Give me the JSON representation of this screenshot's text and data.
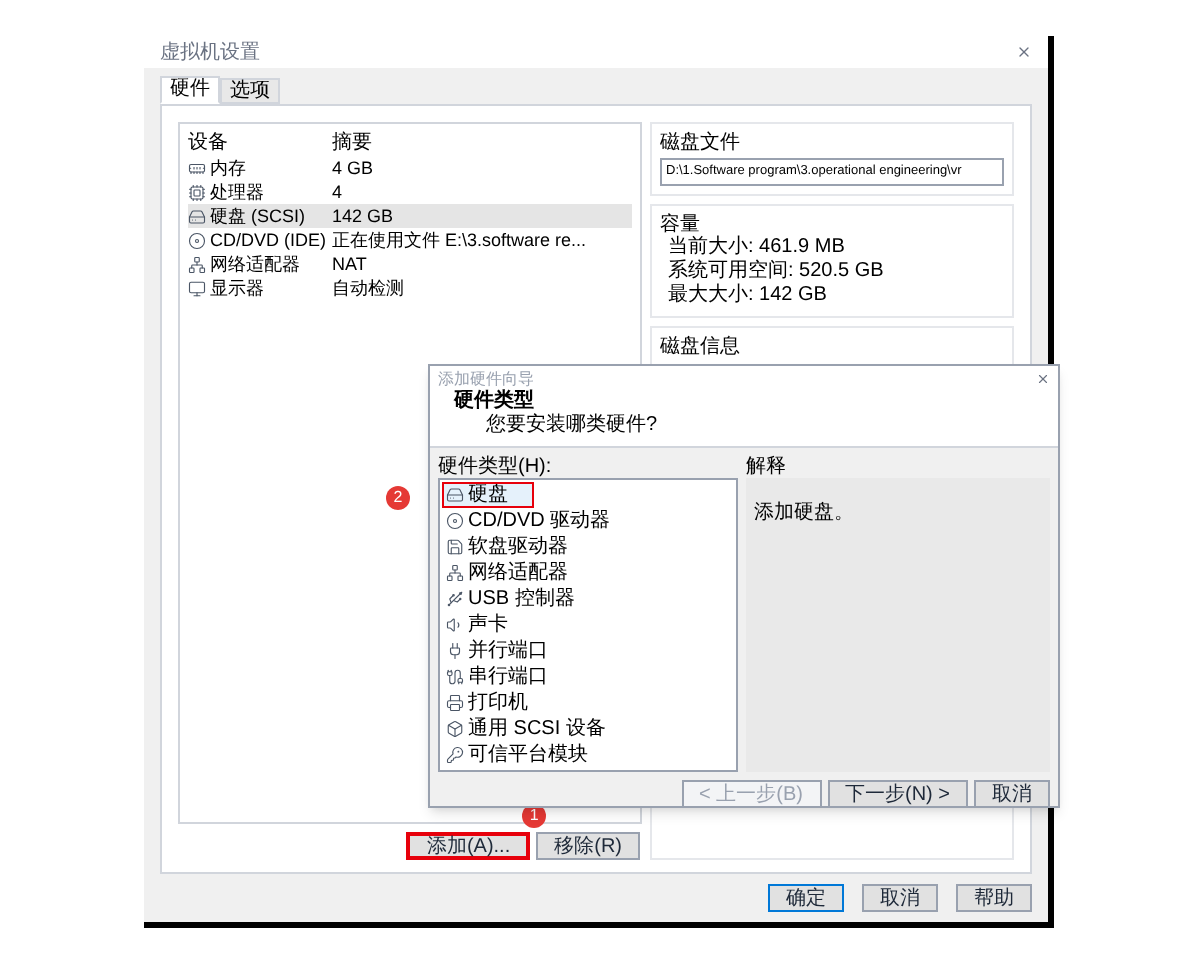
{
  "settings_window": {
    "title": "虚拟机设置",
    "tabs": [
      {
        "label": "硬件",
        "selected": true
      },
      {
        "label": "选项",
        "selected": false
      }
    ],
    "device_table": {
      "columns": [
        "设备",
        "摘要"
      ],
      "rows": [
        {
          "kind": "memory",
          "device": "内存",
          "summary": "4 GB",
          "selected": false
        },
        {
          "kind": "cpu",
          "device": "处理器",
          "summary": "4",
          "selected": false
        },
        {
          "kind": "disk",
          "device": "硬盘 (SCSI)",
          "summary": "142 GB",
          "selected": true
        },
        {
          "kind": "cdrom",
          "device": "CD/DVD (IDE)",
          "summary": "正在使用文件 E:\\3.software re...",
          "selected": false
        },
        {
          "kind": "network",
          "device": "网络适配器",
          "summary": "NAT",
          "selected": false
        },
        {
          "kind": "display",
          "device": "显示器",
          "summary": "自动检测",
          "selected": false
        }
      ]
    },
    "list_buttons": [
      "添加(A)...",
      "移除(R)"
    ],
    "disk_file": {
      "heading": "磁盘文件",
      "value": "D:\\1.Software program\\3.operational engineering\\vr"
    },
    "capacity": {
      "heading": "容量",
      "lines": [
        "当前大小: 461.9 MB",
        "系统可用空间: 520.5 GB",
        "最大大小: 142 GB"
      ]
    },
    "disk_info": {
      "heading": "磁盘信息"
    },
    "buttons": [
      "确定",
      "取消",
      "帮助"
    ]
  },
  "wizard": {
    "title": "添加硬件向导",
    "heading": "硬件类型",
    "subheading": "您要安装哪类硬件?",
    "list_label": "硬件类型(H):",
    "items": [
      {
        "kind": "disk",
        "label": "硬盘",
        "selected": true
      },
      {
        "kind": "cdrom",
        "label": "CD/DVD 驱动器",
        "selected": false
      },
      {
        "kind": "floppy",
        "label": "软盘驱动器",
        "selected": false
      },
      {
        "kind": "network",
        "label": "网络适配器",
        "selected": false
      },
      {
        "kind": "usb",
        "label": "USB 控制器",
        "selected": false
      },
      {
        "kind": "sound",
        "label": "声卡",
        "selected": false
      },
      {
        "kind": "parallel",
        "label": "并行端口",
        "selected": false
      },
      {
        "kind": "serial",
        "label": "串行端口",
        "selected": false
      },
      {
        "kind": "printer",
        "label": "打印机",
        "selected": false
      },
      {
        "kind": "scsi",
        "label": "通用 SCSI 设备",
        "selected": false
      },
      {
        "kind": "tpm",
        "label": "可信平台模块",
        "selected": false
      }
    ],
    "explain_label": "解释",
    "explanation": "添加硬盘。",
    "buttons": [
      {
        "label": "< 上一步(B)",
        "disabled": true
      },
      {
        "label": "下一步(N) >",
        "disabled": false
      },
      {
        "label": "取消",
        "disabled": false
      }
    ]
  },
  "annotations": [
    {
      "kind": "add-button",
      "number": "1"
    },
    {
      "kind": "hardware-item",
      "number": "2"
    }
  ]
}
